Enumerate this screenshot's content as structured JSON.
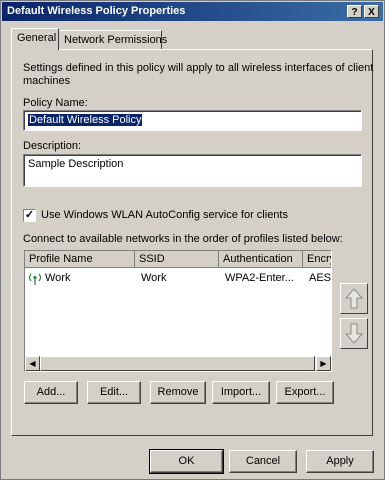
{
  "window": {
    "title": "Default Wireless Policy Properties",
    "help_label": "?",
    "close_label": "X"
  },
  "tabs": [
    {
      "label": "General",
      "active": true
    },
    {
      "label": "Network Permissions",
      "active": false
    }
  ],
  "general": {
    "intro_line1": "Settings defined in this policy will apply to all wireless interfaces of client",
    "intro_line2": "machines",
    "policy_name_label": "Policy Name:",
    "policy_name_value": "Default Wireless Policy",
    "description_label": "Description:",
    "description_value": "Sample Description",
    "autoconfig_checked": true,
    "autoconfig_label": "Use Windows WLAN AutoConfig service for clients",
    "profiles_label": "Connect to available networks in the order of profiles listed below:"
  },
  "profiles_table": {
    "columns": [
      "Profile Name",
      "SSID",
      "Authentication",
      "Encry"
    ],
    "rows": [
      {
        "profile_name": "Work",
        "ssid": "Work",
        "authentication": "WPA2-Enter...",
        "encryption": "AES",
        "icon": "wireless-network-icon"
      }
    ]
  },
  "profile_buttons": {
    "add": "Add...",
    "edit": "Edit...",
    "remove": "Remove",
    "import": "Import...",
    "export": "Export..."
  },
  "order_buttons": {
    "up_icon": "move-up-arrow-icon",
    "down_icon": "move-down-arrow-icon"
  },
  "dialog_buttons": {
    "ok": "OK",
    "cancel": "Cancel",
    "apply": "Apply"
  },
  "colors": {
    "title_bar": "#0a246a",
    "face": "#d4d0c8",
    "selection": "#0a246a"
  }
}
